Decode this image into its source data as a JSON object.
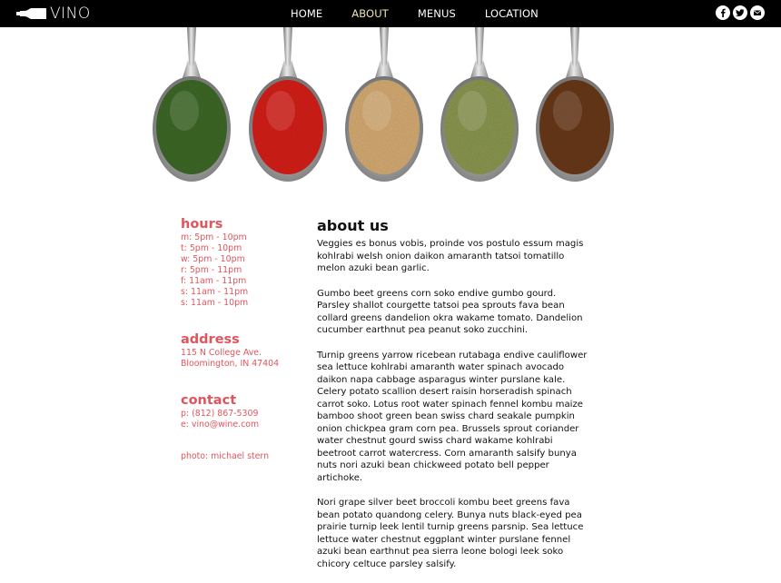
{
  "brand": {
    "name": "VINO"
  },
  "nav": {
    "items": [
      {
        "label": "HOME"
      },
      {
        "label": "ABOUT"
      },
      {
        "label": "MENUS"
      },
      {
        "label": "LOCATION"
      }
    ],
    "active": "ABOUT"
  },
  "social": {
    "icons": [
      "facebook-icon",
      "twitter-icon",
      "email-icon"
    ]
  },
  "hero": {
    "spoon_colors": [
      "#3f6a2c",
      "#d8221c",
      "#d9ae76",
      "#8d9a52",
      "#6b3a1c"
    ]
  },
  "sidebar": {
    "hours": {
      "heading": "hours",
      "lines": [
        "m: 5pm - 10pm",
        "t: 5pm - 10pm",
        "w: 5pm - 10pm",
        "r: 5pm - 11pm",
        "f: 11am - 11pm",
        "s: 11am - 11pm",
        "s: 11am - 10pm"
      ]
    },
    "address": {
      "heading": "address",
      "lines": [
        "115 N College Ave.",
        "Bloomington, IN 47404"
      ]
    },
    "contact": {
      "heading": "contact",
      "lines": [
        "p: (812) 867-5309",
        "e: vino@wine.com"
      ]
    },
    "photo_credit": "photo: michael stern"
  },
  "main": {
    "title": "about us",
    "paragraphs": [
      "Veggies es bonus vobis, proinde vos postulo essum magis kohlrabi welsh onion daikon amaranth tatsoi tomatillo melon azuki bean garlic.",
      "Gumbo beet greens corn soko endive gumbo gourd. Parsley shallot courgette tatsoi pea sprouts fava bean collard greens dandelion okra wakame tomato. Dandelion cucumber earthnut pea peanut soko zucchini.",
      "Turnip greens yarrow ricebean rutabaga endive cauliflower sea lettuce kohlrabi amaranth water spinach avocado daikon napa cabbage asparagus winter purslane kale. Celery potato scallion desert raisin horseradish spinach carrot soko. Lotus root water spinach fennel kombu maize bamboo shoot green bean swiss chard seakale pumpkin onion chickpea gram corn pea. Brussels sprout coriander water chestnut gourd swiss chard wakame kohlrabi beetroot carrot watercress. Corn amaranth salsify bunya nuts nori azuki bean chickweed potato bell pepper artichoke.",
      "Nori grape silver beet broccoli kombu beet greens fava bean potato quandong celery. Bunya nuts black-eyed pea prairie turnip leek lentil turnip greens parsnip. Sea lettuce lettuce water chestnut eggplant winter purslane fennel azuki bean earthnut pea sierra leone bologi leek soko chicory celtuce parsley salsify."
    ]
  }
}
